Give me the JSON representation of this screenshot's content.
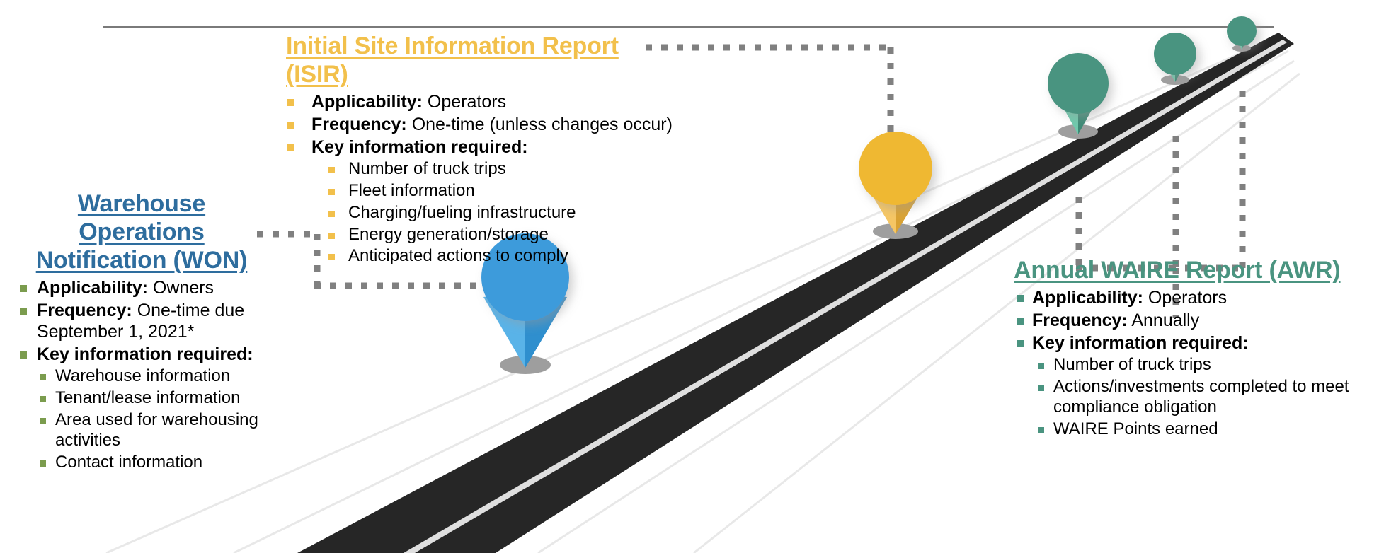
{
  "diagram": {
    "type": "roadmap-infographic",
    "top_rule_color": "#7A7A7A",
    "road_color": "#262626",
    "road_stripe_color": "#EFEFEF",
    "guide_line_color": "#E8E8E8",
    "connector_color": "#808080",
    "pin_shadow_color": "#9E9E9E"
  },
  "colors": {
    "won_accent": "#2E6D9E",
    "isir_accent": "#F2C04B",
    "awr_accent": "#4A9480",
    "won_bullet": "#7B9C4E",
    "isir_bullet": "#F2C04B",
    "awr_bullet": "#4A9480"
  },
  "pins": [
    {
      "name": "won-pin",
      "color": "#3D9BDB",
      "label": "Warehouse Operations Notification"
    },
    {
      "name": "isir-pin",
      "color": "#EFB830",
      "label": "Initial Site Information Report"
    },
    {
      "name": "awr-pin-large",
      "color": "#4A9480",
      "label": "Annual WAIRE Report"
    },
    {
      "name": "awr-pin-medium",
      "color": "#4A9480",
      "label": "Annual WAIRE Report"
    },
    {
      "name": "awr-pin-small",
      "color": "#4A9480",
      "label": "Annual WAIRE Report"
    }
  ],
  "blocks": {
    "won": {
      "title_line1": "Warehouse Operations",
      "title_line2": "Notification (WON)",
      "items": [
        {
          "label": "Applicability:",
          "value": " Owners"
        },
        {
          "label": "Frequency:",
          "value": " One-time due September 1, 2021*"
        },
        {
          "label": "Key information required:",
          "value": ""
        }
      ],
      "sub_items": [
        "Warehouse information",
        "Tenant/lease information",
        "Area used for warehousing activities",
        "Contact information"
      ]
    },
    "isir": {
      "title": "Initial Site Information Report (ISIR)",
      "items": [
        {
          "label": "Applicability:",
          "value": " Operators"
        },
        {
          "label": "Frequency:",
          "value": " One-time (unless changes occur)"
        },
        {
          "label": "Key information required:",
          "value": ""
        }
      ],
      "sub_items": [
        "Number of truck trips",
        "Fleet information",
        "Charging/fueling infrastructure",
        "Energy generation/storage",
        "Anticipated actions to comply"
      ]
    },
    "awr": {
      "title": "Annual WAIRE Report (AWR)",
      "items": [
        {
          "label": "Applicability:",
          "value": " Operators"
        },
        {
          "label": "Frequency:",
          "value": " Annually"
        },
        {
          "label": "Key information required:",
          "value": ""
        }
      ],
      "sub_items": [
        "Number of truck trips",
        "Actions/investments completed to meet compliance obligation",
        "WAIRE Points earned"
      ]
    }
  }
}
